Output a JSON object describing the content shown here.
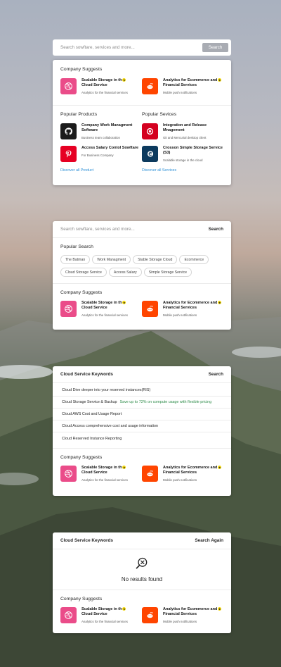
{
  "colors": {
    "dribbble": "#ea4c89",
    "reddit": "#ff4500",
    "github": "#1b1b1b",
    "pinterest": "#e60023",
    "target": "#d4001f",
    "crosson": "#0c3a5e",
    "link": "#2b8fd6",
    "highlight": "#2e8c4a"
  },
  "card1": {
    "search_placeholder": "Search sowftare, services and more...",
    "search_button": "Search",
    "suggests_title": "Company Suggests",
    "suggests": [
      {
        "name": "Scalable Storage in th",
        "name2": "Cloud Service",
        "sub": "Analytics for the financial services",
        "icon": "dribbble-icon"
      },
      {
        "name": "Analytics for Ecommerce and",
        "name2": "Financial Services",
        "sub": "Mobile push notifications",
        "icon": "reddit-icon"
      }
    ],
    "products_title": "Popular Products",
    "services_title": "Popular Sevices",
    "products": [
      {
        "name": "Company Work Managment Software",
        "sub": "Business team collaboration",
        "icon": "github-icon"
      },
      {
        "name": "Access Salary Contol Sowftare",
        "sub": "For Business Company",
        "icon": "pinterest-icon"
      }
    ],
    "services": [
      {
        "name": "Integration and Release Mnagement",
        "sub": "Git and Mercurial desktop client",
        "icon": "target-icon"
      },
      {
        "name": "Crosson Simple Storage Service (S3)",
        "sub": "Scalable storage in the cloud",
        "icon": "crosson-icon"
      }
    ],
    "discover_products": "Discover all Product",
    "discover_services": "Discover all Services"
  },
  "card2": {
    "search_placeholder": "Search sowftare, services and more...",
    "search_action": "Search",
    "popular_title": "Popular Search",
    "chips": [
      "The Batman",
      "Work Managment",
      "Stable Storage Cloud",
      "Ecommerce",
      "Cloud Storage Service",
      "Access Salary",
      "Simple Storage Service"
    ],
    "suggests_title": "Company Suggests",
    "suggests": [
      {
        "name": "Scalable Storage in th",
        "name2": "Cloud Service",
        "sub": "Analytics for the financial services"
      },
      {
        "name": "Analytics for Ecommerce and",
        "name2": "Financial Services",
        "sub": "Mobile push notifications"
      }
    ]
  },
  "card3": {
    "query": "Cloud Service Keywords",
    "search_action": "Search",
    "keywords": [
      {
        "text": "Cloud Dive deeper into your reserved instances(RIS)",
        "extra": ""
      },
      {
        "text": "Cloud Storage Service & Backup",
        "extra": "Save up to 72% on compute usage with flexible pricing"
      },
      {
        "text": "Cloud AWS Cost and Usage Report",
        "extra": ""
      },
      {
        "text": "Cloud Access comprehensive cost and usage information",
        "extra": ""
      },
      {
        "text": "Cloud Reserved Instance Reporting",
        "extra": ""
      }
    ],
    "suggests_title": "Company Suggests",
    "suggests": [
      {
        "name": "Scalable Storage in th",
        "name2": "Cloud Service",
        "sub": "Analytics for the financial services"
      },
      {
        "name": "Analytics for Ecommerce and",
        "name2": "Financial Services",
        "sub": "Mobile push notifications"
      }
    ]
  },
  "card4": {
    "query": "Cloud Service Keywords",
    "search_action": "Search Again",
    "no_results": "No results found",
    "empty_icon": "search-no-results-icon",
    "suggests_title": "Company Suggests",
    "suggests": [
      {
        "name": "Scalable Storage in th",
        "name2": "Cloud Service",
        "sub": "Analytics for the financial services"
      },
      {
        "name": "Analytics for Ecommerce and",
        "name2": "Financial Services",
        "sub": "Mobile push notifications"
      }
    ]
  }
}
